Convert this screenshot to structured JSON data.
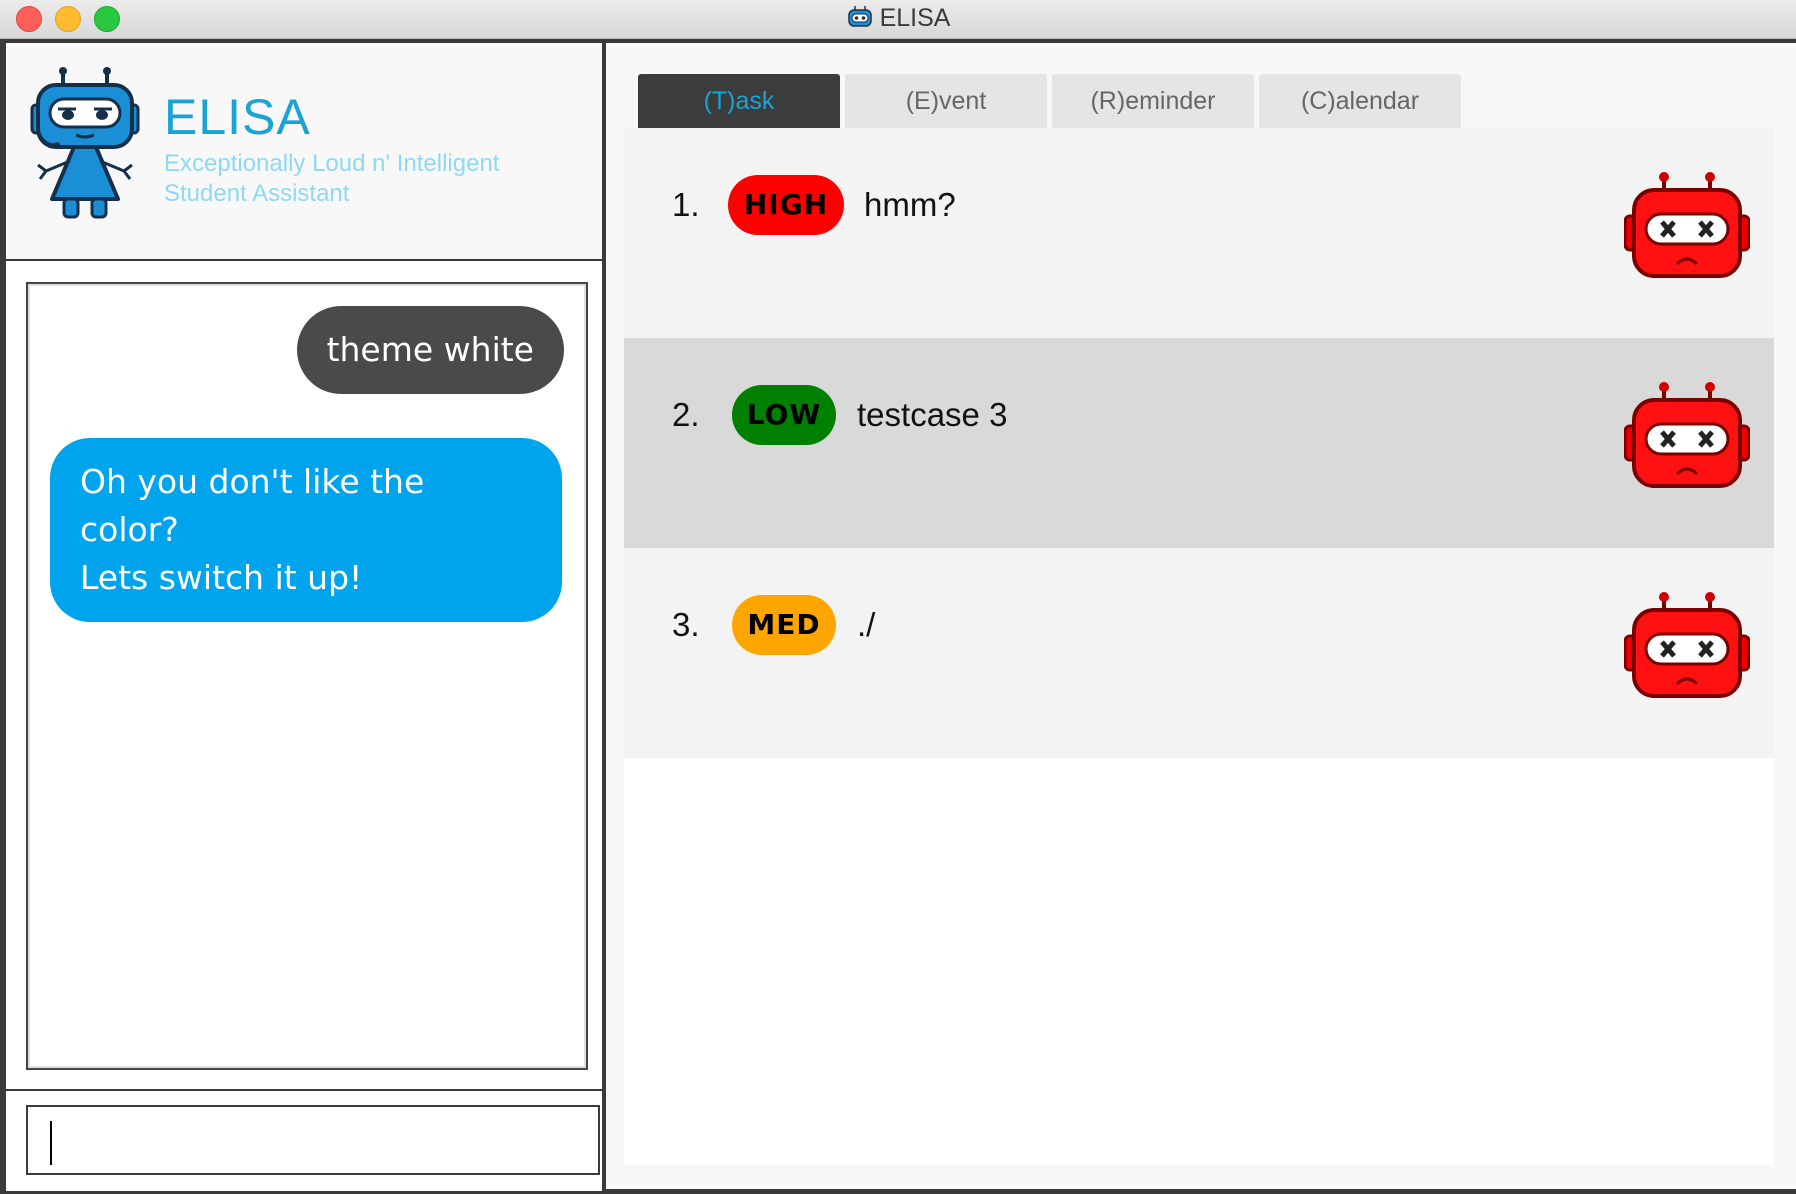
{
  "window": {
    "title": "ELISA"
  },
  "header": {
    "app_name": "ELISA",
    "tagline_line1": "Exceptionally Loud n' Intelligent",
    "tagline_line2": "Student Assistant"
  },
  "chat": {
    "messages": [
      {
        "from": "user",
        "text": "theme white"
      },
      {
        "from": "bot",
        "line1": "Oh you don't like the color?",
        "line2": "Lets switch it up!"
      }
    ]
  },
  "input": {
    "value": ""
  },
  "tabs": [
    {
      "label": "(T)ask",
      "active": true
    },
    {
      "label": "(E)vent",
      "active": false
    },
    {
      "label": "(R)eminder",
      "active": false
    },
    {
      "label": "(C)alendar",
      "active": false
    }
  ],
  "tasks": [
    {
      "number": "1.",
      "priority": "HIGH",
      "priority_color": "#fe0000",
      "description": "hmm?",
      "status_icon": "robot-sad-icon"
    },
    {
      "number": "2.",
      "priority": "LOW",
      "priority_color": "#008000",
      "description": "testcase 3",
      "status_icon": "robot-sad-icon"
    },
    {
      "number": "3.",
      "priority": "MED",
      "priority_color": "#ffa500",
      "description": "./",
      "status_icon": "robot-sad-icon"
    }
  ],
  "colors": {
    "accent": "#1aa3d4",
    "bot_bubble": "#00a4ec",
    "user_bubble": "#4a4a4a",
    "row_even": "#f3f3f3",
    "row_odd": "#d9d9d9"
  }
}
